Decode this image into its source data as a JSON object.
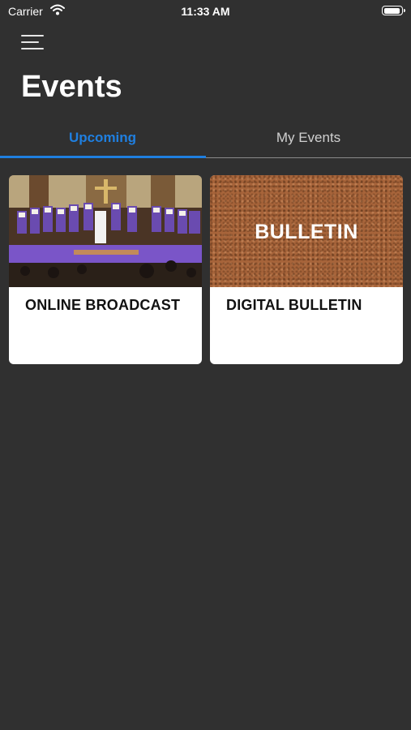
{
  "status_bar": {
    "carrier": "Carrier",
    "time": "11:33 AM"
  },
  "header": {
    "title": "Events"
  },
  "tabs": [
    {
      "label": "Upcoming",
      "active": true
    },
    {
      "label": "My Events",
      "active": false
    }
  ],
  "cards": [
    {
      "title": "ONLINE BROADCAST",
      "image": "church-choir-photo"
    },
    {
      "title": "DIGITAL BULLETIN",
      "image": "corkboard-bulletin",
      "image_text": "BULLETIN"
    }
  ],
  "colors": {
    "background": "#303030",
    "accent": "#1f7fe0",
    "card": "#ffffff"
  }
}
